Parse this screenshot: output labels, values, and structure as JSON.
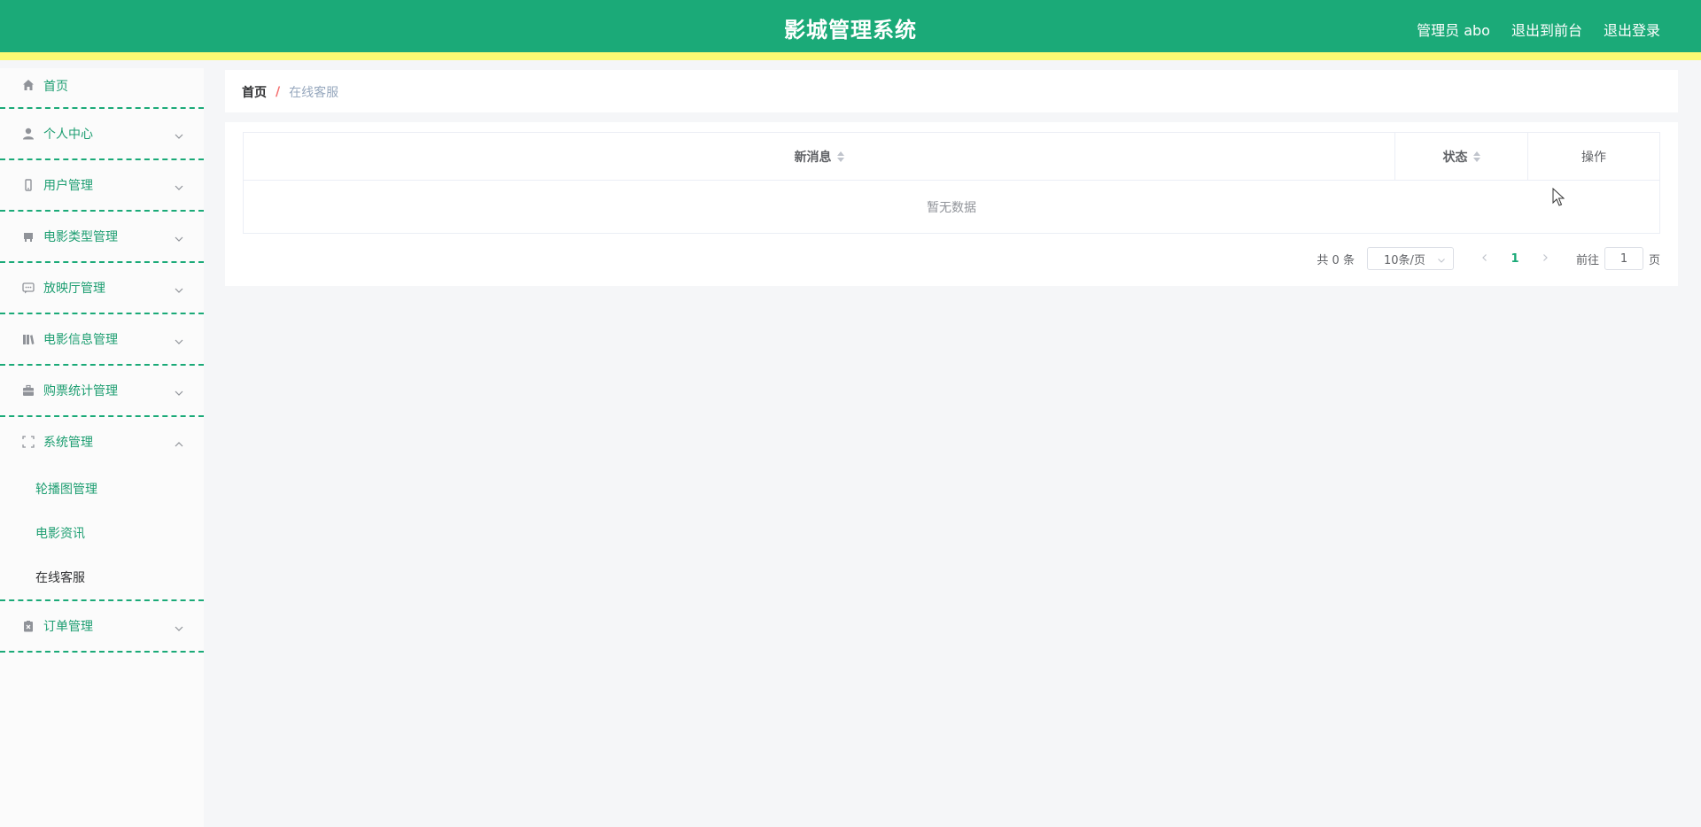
{
  "header": {
    "title": "影城管理系统",
    "admin_label": "管理员 abo",
    "exit_front": "退出到前台",
    "logout": "退出登录"
  },
  "sidebar": {
    "items": [
      {
        "label": "首页",
        "icon": "home-icon"
      },
      {
        "label": "个人中心",
        "icon": "user-icon"
      },
      {
        "label": "用户管理",
        "icon": "mobile-icon"
      },
      {
        "label": "电影类型管理",
        "icon": "film-type-icon"
      },
      {
        "label": "放映厅管理",
        "icon": "chat-icon"
      },
      {
        "label": "电影信息管理",
        "icon": "books-icon"
      },
      {
        "label": "购票统计管理",
        "icon": "briefcase-icon"
      },
      {
        "label": "系统管理",
        "icon": "fullscreen-icon",
        "expanded": true,
        "children": [
          "轮播图管理",
          "电影资讯",
          "在线客服"
        ],
        "active_child": "在线客服"
      },
      {
        "label": "订单管理",
        "icon": "clipboard-icon"
      }
    ]
  },
  "breadcrumb": {
    "home": "首页",
    "separator": "/",
    "current": "在线客服"
  },
  "table": {
    "columns": [
      "新消息",
      "状态",
      "操作"
    ],
    "empty_text": "暂无数据"
  },
  "pagination": {
    "total": "共 0 条",
    "page_size": "10条/页",
    "current_page": "1",
    "goto_label": "前往",
    "goto_value": "1",
    "page_suffix": "页"
  },
  "colors": {
    "primary": "#1baa78",
    "accent_yellow": "#fafa73",
    "breadcrumb_sep": "#f56c6c"
  }
}
